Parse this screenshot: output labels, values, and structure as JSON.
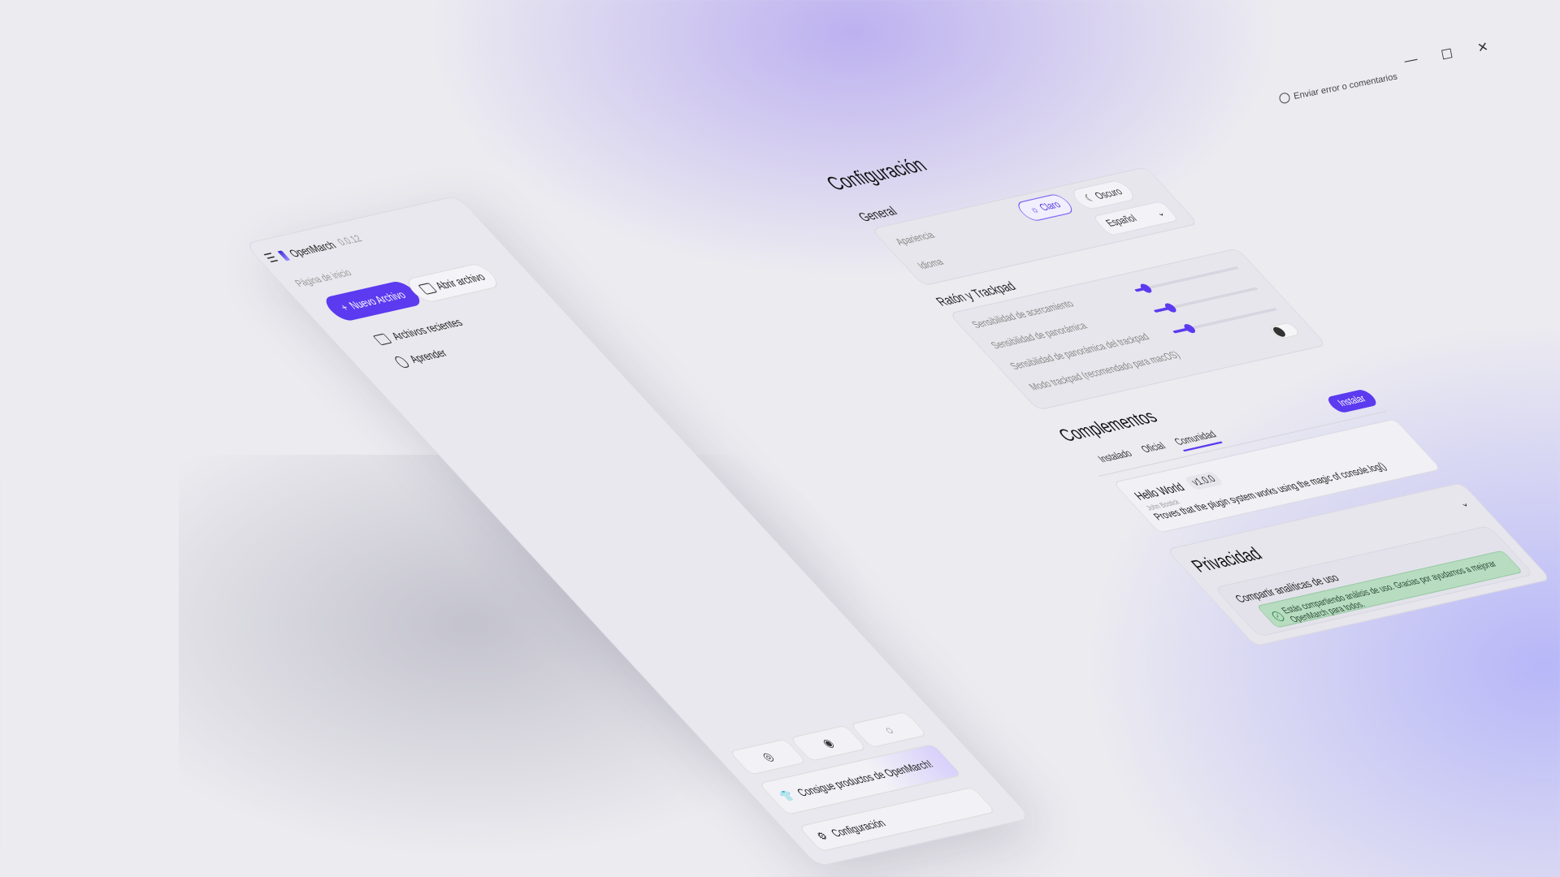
{
  "window": {
    "feedback_label": "Enviar error o comentarios",
    "minimize_glyph": "—",
    "maximize_glyph": "☐",
    "close_glyph": "✕"
  },
  "sidebar": {
    "app_name": "OpenMarch",
    "version": "0.0.12",
    "section_label": "Página de inicio",
    "new_file_label": "Nuevo Archivo",
    "open_file_label": "Abrir archivo",
    "recent_label": "Archivos recientes",
    "learn_label": "Aprender",
    "social_icons": [
      "discord-icon",
      "github-icon",
      "feedback-icon"
    ],
    "merch_label": "Consigue productos de OpenMarch!",
    "settings_label": "Configuración"
  },
  "settings": {
    "title": "Configuración",
    "general": {
      "title": "General",
      "appearance_label": "Apariencia",
      "language_label": "Idioma",
      "theme_light": "Claro",
      "theme_dark": "Oscuro",
      "theme_selected": "Claro",
      "language_value": "Español"
    },
    "mouse": {
      "title": "Ratón y Trackpad",
      "zoom_label": "Sensibilidad de acercamiento",
      "pan_label": "Sensibilidad de panorámica",
      "trackpad_pan_label": "Sensibilidad de panorámica del trackpad",
      "trackpad_mode_label": "Modo trackpad (recomendado para macOS)",
      "zoom_level": 0.1,
      "pan_level": 0.15,
      "trackpad_pan_level": 0.15,
      "trackpad_mode_on": false
    },
    "plugins": {
      "title": "Complementos",
      "tabs": [
        "Instalado",
        "Oficial",
        "Comunidad"
      ],
      "active_tab": "Comunidad",
      "install_label": "Instalar",
      "plugin": {
        "name": "Hello World",
        "version": "v1.0.0",
        "author": "John Bostick",
        "description": "Proves that the plugin system works using the magic of console.log()"
      }
    },
    "privacy": {
      "title": "Privacidad",
      "share_label": "Compartir analíticas de uso",
      "notice": "Estás compartiendo análisis de uso. Gracias por ayudarnos a mejorar OpenMarch para todos."
    }
  },
  "colors": {
    "accent": "#5b3af0",
    "success_bg": "#b7dcc0"
  }
}
